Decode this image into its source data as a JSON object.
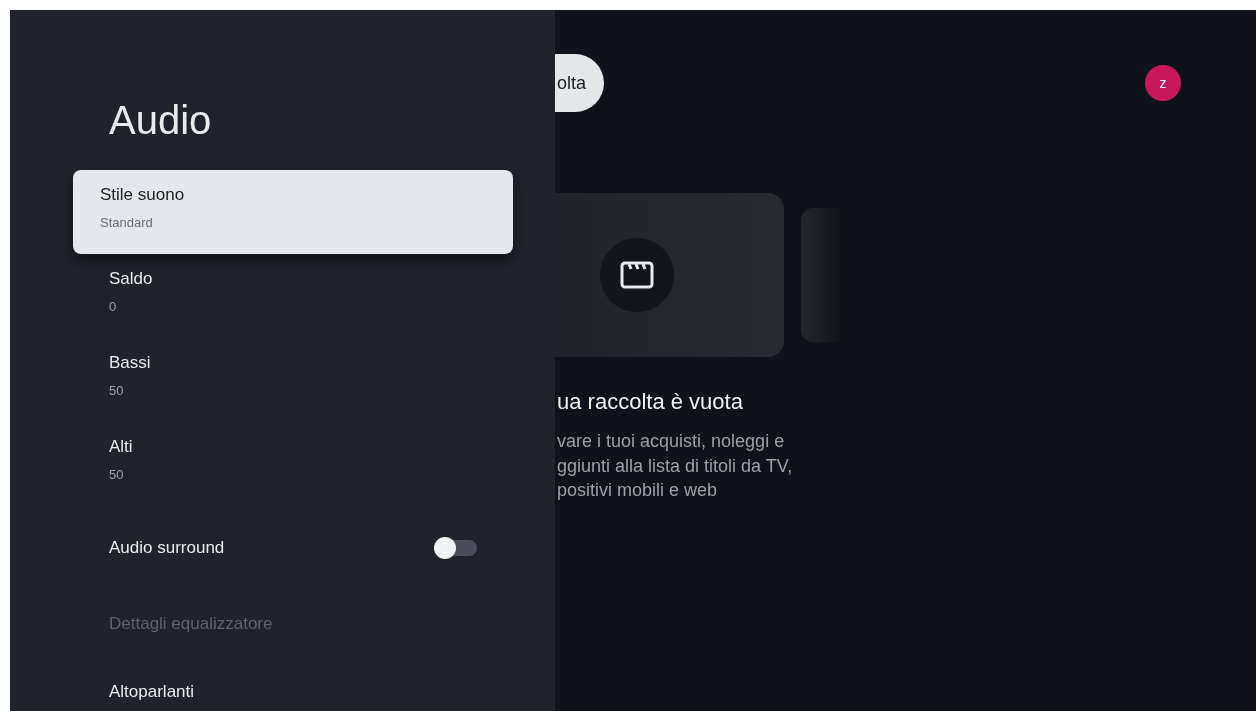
{
  "settings_panel": {
    "title": "Audio",
    "items": [
      {
        "kind": "value",
        "title": "Stile suono",
        "value": "Standard",
        "selected": true,
        "disabled": false
      },
      {
        "kind": "value",
        "title": "Saldo",
        "value": "0",
        "selected": false,
        "disabled": false
      },
      {
        "kind": "value",
        "title": "Bassi",
        "value": "50",
        "selected": false,
        "disabled": false
      },
      {
        "kind": "value",
        "title": "Alti",
        "value": "50",
        "selected": false,
        "disabled": false
      },
      {
        "kind": "toggle",
        "title": "Audio surround",
        "on": false,
        "selected": false,
        "disabled": false
      },
      {
        "kind": "link",
        "title": "Dettagli equalizzatore",
        "selected": false,
        "disabled": true
      },
      {
        "kind": "link",
        "title": "Altoparlanti",
        "selected": false,
        "disabled": false
      }
    ]
  },
  "background_screen": {
    "tab": "olta",
    "avatar": "z",
    "empty_title": "ua raccolta è vuota",
    "empty_lines": [
      "vare i tuoi acquisti, noleggi e",
      "ggiunti alla lista di titoli da TV,",
      "positivi mobili e web"
    ]
  }
}
